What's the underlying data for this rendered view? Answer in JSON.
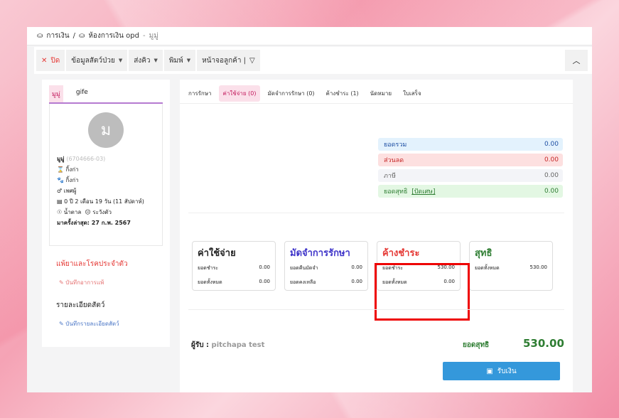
{
  "breadcrumb": {
    "root": "การเงิน",
    "sep": "/",
    "page": "ห้องการเงิน opd",
    "dash": "-",
    "patient": "มูมู่"
  },
  "toolbar": {
    "close": "ปิด",
    "pet_info": "ข้อมูลสัตว์ป่วย",
    "queue": "ส่งคิว",
    "print": "พิมพ์",
    "customer_screen": "หน้าจอลูกค้า |"
  },
  "sidebar": {
    "tabs": [
      "มูมู่",
      "gife"
    ],
    "avatar_letter": "ม",
    "name": "มูมู่",
    "id": "(6704666-03)",
    "species": "กิ้งก่า",
    "breed": "กิ้งก่า",
    "sex": "เพศผู้",
    "age": "0 ปี 2 เดือน 19 วัน (11 สัปดาห์)",
    "color": "น้ำตาล",
    "temper": "ระวังตัว",
    "last_visit": "มาครั้งล่าสุด: 27 ก.พ. 2567",
    "allergy_title": "แพ้ยาและโรคประจำตัว",
    "allergy_link": "บันทึกอาการแพ้",
    "detail_title": "รายละเอียดสัตว์",
    "detail_link": "บันทึกรายละเอียดสัตว์"
  },
  "tabs": [
    "การรักษา",
    "ค่าใช้จ่าย (0)",
    "มัดจำการรักษา (0)",
    "ค้างชำระ (1)",
    "นัดหมาย",
    "ใบเสร็จ"
  ],
  "summary": {
    "total_label": "ยอดรวม",
    "total": "0.00",
    "discount_label": "ส่วนลด",
    "discount": "0.00",
    "tax_label": "ภาษี",
    "tax": "0.00",
    "net_label": "ยอดสุทธิ",
    "round_label": "[ปัดเศษ]",
    "net": "0.00"
  },
  "cards": {
    "expense": {
      "title": "ค่าใช้จ่าย",
      "r1": "ยอดชำระ",
      "v1": "0.00",
      "r2": "ยอดทั้งหมด",
      "v2": "0.00"
    },
    "deposit": {
      "title": "มัดจำการรักษา",
      "r1": "ยอดคืนมัดจำ",
      "v1": "0.00",
      "r2": "ยอดคงเหลือ",
      "v2": "0.00"
    },
    "outstanding": {
      "title": "ค้างชำระ",
      "r1": "ยอดชำระ",
      "v1": "530.00",
      "r2": "ยอดทั้งหมด",
      "v2": "0.00"
    },
    "net": {
      "title": "สุทธิ",
      "r1": "ยอดทั้งหมด",
      "v1": "530.00"
    }
  },
  "footer": {
    "receiver_label": "ผู้รับ :",
    "receiver": "pitchapa test",
    "net_label": "ยอดสุทธิ",
    "net": "530.00",
    "pay_button": "รับเงิน"
  }
}
